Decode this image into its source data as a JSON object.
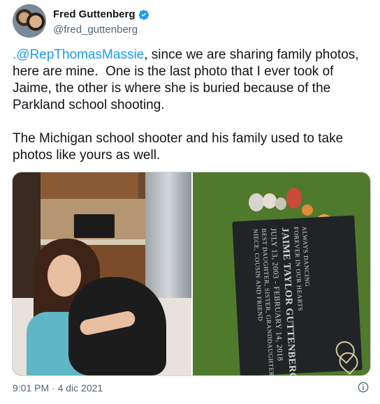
{
  "author": {
    "display_name": "Fred Guttenberg",
    "handle": "@fred_guttenberg",
    "verified": true
  },
  "tweet": {
    "mention": ".@RepThomasMassie",
    "body_after_mention": ", since we are sharing family photos, here are mine.  One is the last photo that I ever took of Jaime, the other is where she is buried because of the Parkland school shooting.\n\nThe Michigan school shooter and his family used to take photos like yours as well."
  },
  "gravestone": {
    "line1": "ALWAYS DANCING",
    "line2": "FOREVER IN OUR HEARTS",
    "line3": "JAIME TAYLOR GUTTENBERG",
    "line4": "JULY 13, 2003 - FEBRUARY 14, 2018",
    "line5": "BEST DAUGHTER, SISTER, GRANDDAUGHTER",
    "line6": "NIECE, COUSIN AND FRIEND"
  },
  "footer": {
    "timestamp": "9:01 PM · 4 dic 2021"
  },
  "colors": {
    "link": "#1d9bf0",
    "secondary_text": "#536471",
    "verified_badge": "#1d9bf0"
  },
  "icons": {
    "verified": "verified-badge-icon",
    "info": "info-icon"
  }
}
